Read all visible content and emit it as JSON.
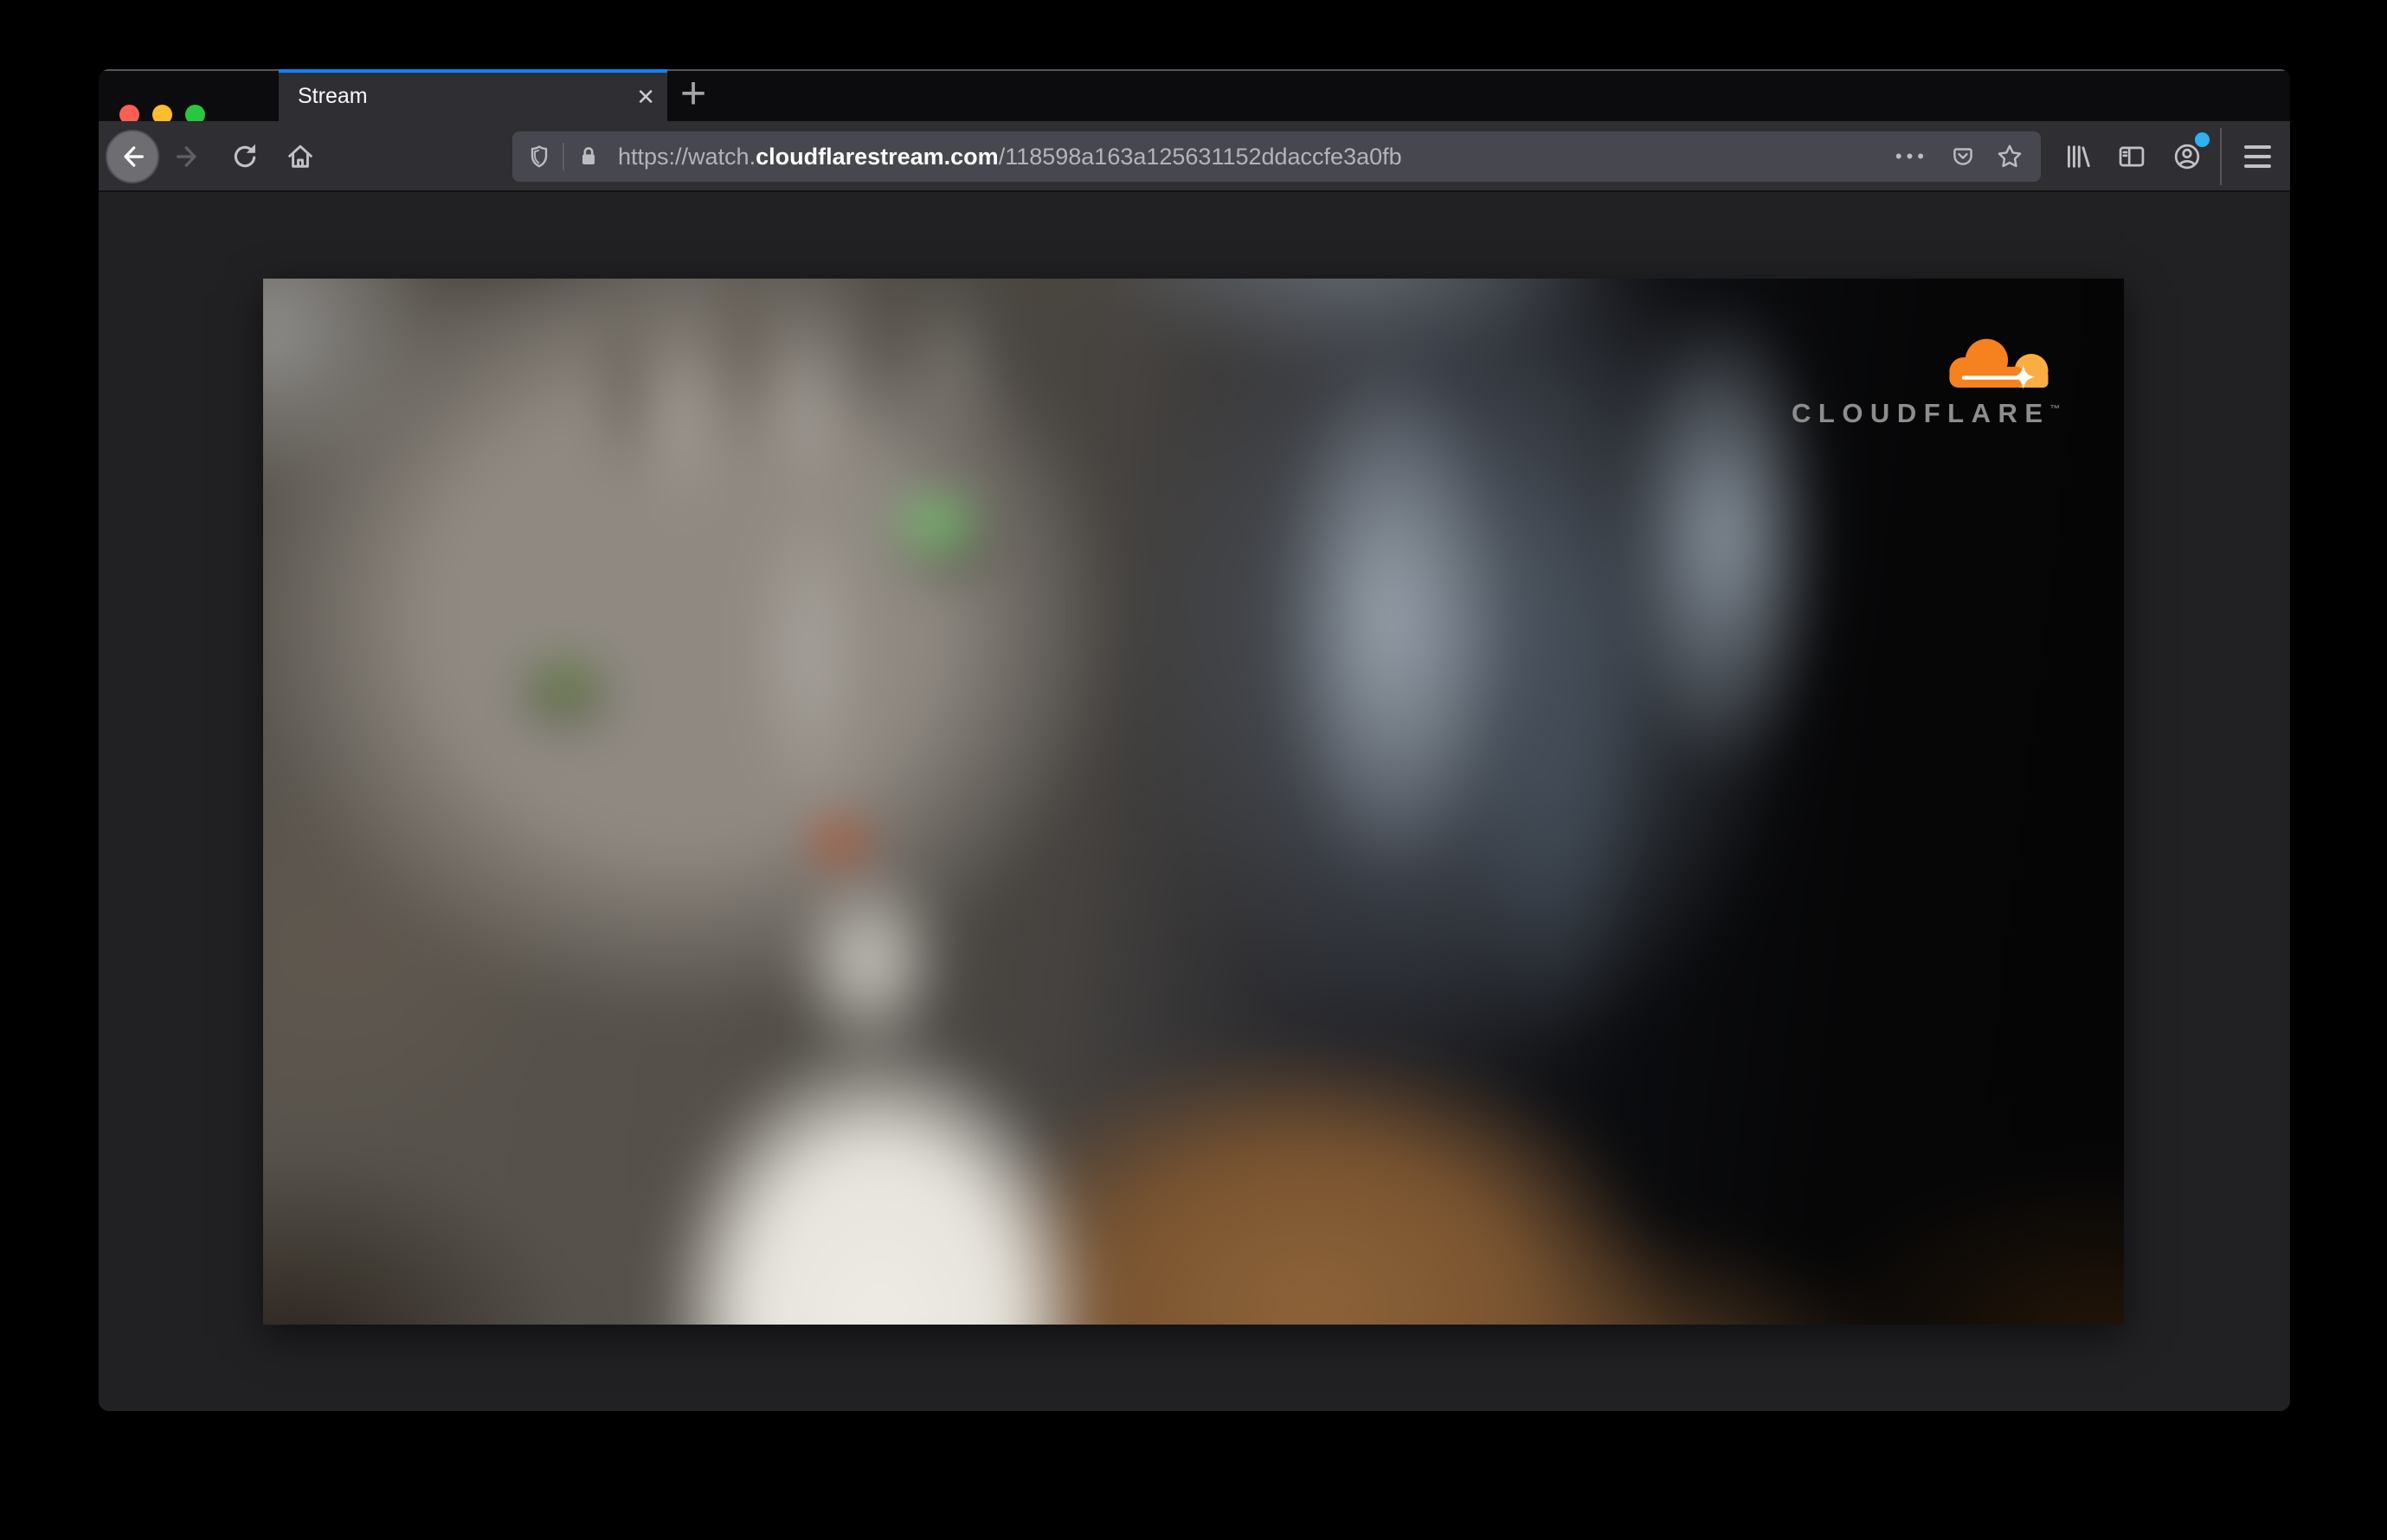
{
  "tab_bar": {
    "tab_title": "Stream",
    "close_icon": "✕",
    "new_tab_icon": "+"
  },
  "urlbar": {
    "prefix": "https://watch.",
    "domain": "cloudflarestream.com",
    "path": "/118598a163a125631152ddaccfe3a0fb",
    "page_actions_icon": "•••"
  },
  "video": {
    "watermark": {
      "brand": "CLOUDFLARE",
      "tm": "™"
    }
  },
  "icons": {
    "window_controls": [
      "close",
      "minimize",
      "zoom"
    ],
    "navigation": [
      "back-arrow",
      "forward-arrow",
      "reload",
      "home"
    ],
    "urlbar_left": [
      "tracking-protection-shield",
      "connection-secure-lock"
    ],
    "urlbar_right": [
      "page-actions-dots",
      "save-to-pocket",
      "bookmark-star"
    ],
    "toolbar_right": [
      "library",
      "sidebar",
      "account",
      "hamburger-menu"
    ],
    "watermark": [
      "cloudflare-cloud"
    ]
  },
  "colors": {
    "active_tab_accent": "#0a84ff",
    "traffic_close": "#ff5e57",
    "traffic_minimize": "#fdbc2e",
    "traffic_zoom": "#29c73f",
    "account_badge": "#2fb1f1",
    "logo_orange": "#f6821f",
    "logo_orange_light": "#fbad41",
    "watermark_text": "#8d8d8d"
  }
}
